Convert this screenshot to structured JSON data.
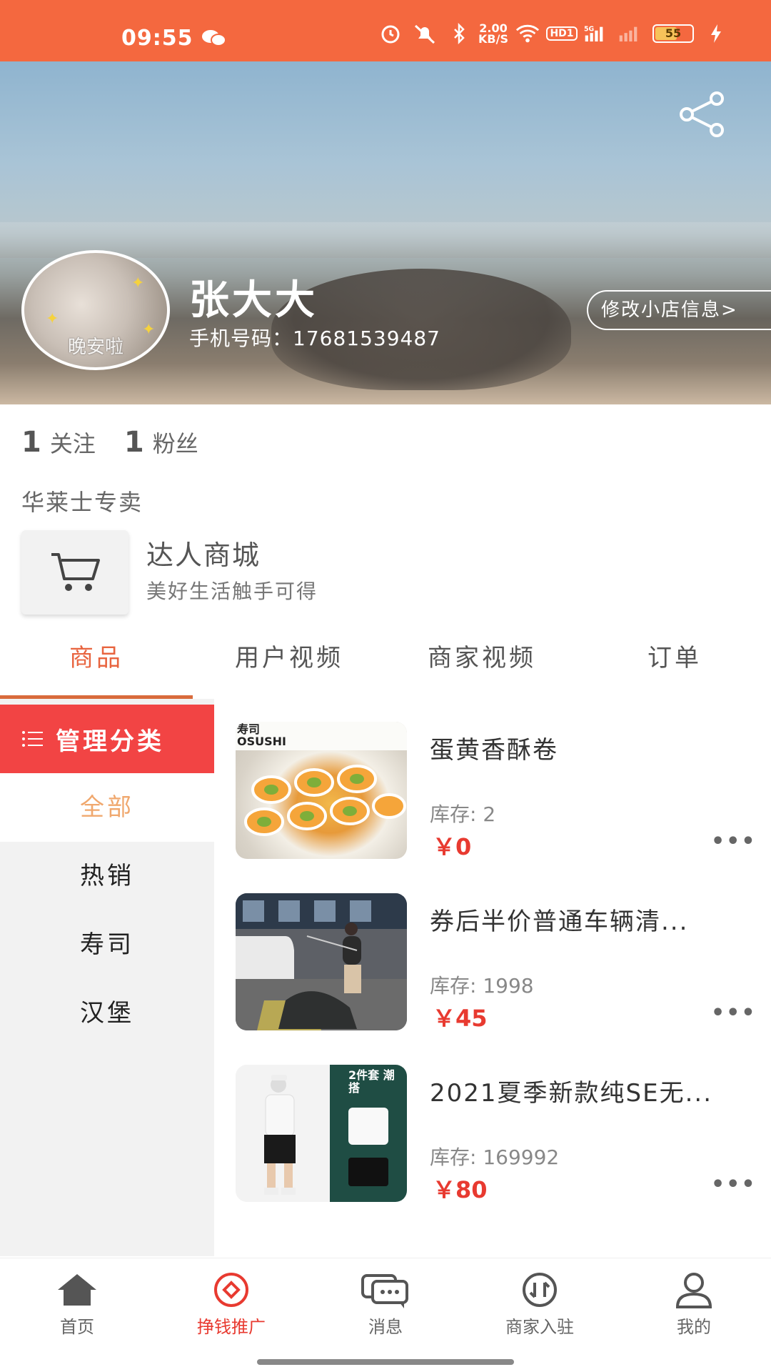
{
  "status_bar": {
    "time": "09:55",
    "speed": "2.00\nKB/S",
    "speed_top": "2.00",
    "speed_bottom": "KB/S",
    "hd_label": "HD1",
    "network": "5G",
    "battery": "55",
    "battery_fraction": 0.55
  },
  "shop": {
    "name": "张大大",
    "phone": "手机号码：17681539487",
    "avatar_caption": "晚安啦",
    "edit_button": "修改小店信息>",
    "following_count": "1",
    "following_label": "关注",
    "fans_count": "1",
    "fans_label": "粉丝",
    "description": "华莱士专卖"
  },
  "mall": {
    "title": "达人商城",
    "subtitle": "美好生活触手可得"
  },
  "tabs": [
    {
      "label": "商品",
      "active": true
    },
    {
      "label": "用户视频",
      "active": false
    },
    {
      "label": "商家视频",
      "active": false
    },
    {
      "label": "订单",
      "active": false
    }
  ],
  "categories": {
    "manage_label": "管理分类",
    "items": [
      {
        "label": "全部",
        "active": true
      },
      {
        "label": "热销",
        "active": false
      },
      {
        "label": "寿司",
        "active": false
      },
      {
        "label": "汉堡",
        "active": false
      }
    ]
  },
  "products": [
    {
      "name": "蛋黄香酥卷",
      "stock": "库存: 2",
      "price": "￥0",
      "more": "•••",
      "thumb_text": "寿司 OSUSHI"
    },
    {
      "name": "券后半价普通车辆清...",
      "stock": "库存: 1998",
      "price": "￥45",
      "more": "•••"
    },
    {
      "name": "2021夏季新款纯SE无...",
      "stock": "库存: 169992",
      "price": "￥80",
      "more": "•••",
      "thumb_text": "2件套 潮搭"
    }
  ],
  "bottom_nav": [
    {
      "label": "首页",
      "icon": "home-icon",
      "active": false
    },
    {
      "label": "挣钱推广",
      "icon": "promote-icon",
      "active": true
    },
    {
      "label": "消息",
      "icon": "message-icon",
      "active": false
    },
    {
      "label": "商家入驻",
      "icon": "merchant-icon",
      "active": false
    },
    {
      "label": "我的",
      "icon": "profile-icon",
      "active": false
    }
  ],
  "colors": {
    "status_bar": "#f4683f",
    "accent_red": "#e83a30",
    "tab_active": "#e8643f",
    "manage_bg": "#f24444",
    "category_active": "#f0a86e"
  }
}
